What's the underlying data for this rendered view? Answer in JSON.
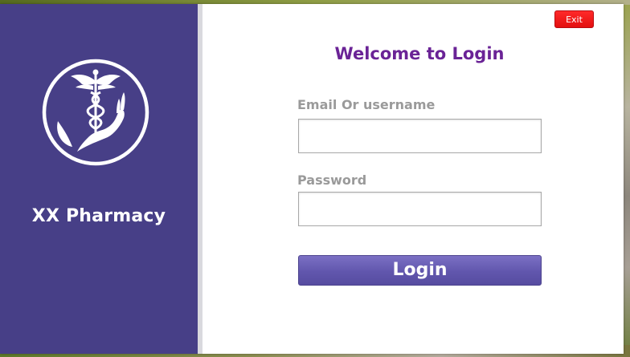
{
  "app": {
    "brand_name": "XX Pharmacy",
    "logo_icon": "caduceus-hand-icon"
  },
  "header": {
    "exit_label": "Exit"
  },
  "form": {
    "title": "Welcome to Login",
    "email_label": "Email Or username",
    "email_value": "",
    "password_label": "Password",
    "password_value": "",
    "login_label": "Login"
  },
  "colors": {
    "sidebar": "#473f87",
    "title": "#6a2396",
    "login_button": "#6156ad",
    "exit_button": "#e30f0f"
  }
}
